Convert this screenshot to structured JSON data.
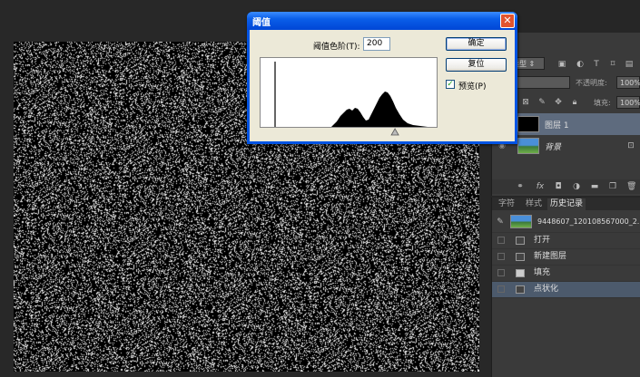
{
  "layers_panel": {
    "kind_label": "类型",
    "opacity_label": "不透明度:",
    "opacity_value": "100%",
    "fill_label": "填充:",
    "fill_value": "100%",
    "layers": [
      {
        "name": "图层 1",
        "thumb": "black",
        "selected": true
      },
      {
        "name": "背景",
        "thumb": "landscape",
        "italic": true
      }
    ]
  },
  "history_panel": {
    "tabs": [
      "字符",
      "样式",
      "历史记录"
    ],
    "active_tab": 2,
    "snapshot_name": "9448607_120108567000_2...",
    "items": [
      "打开",
      "新建图层",
      "填充",
      "点状化"
    ],
    "selected_index": 3
  },
  "dialog": {
    "title": "阈值",
    "threshold_label": "阈值色阶(T):",
    "threshold_value": "200",
    "ok_label": "确定",
    "reset_label": "复位",
    "preview_label": "预览(P)",
    "preview_checked": true,
    "threshold_fraction": 0.78
  },
  "colors": {
    "titlebar": "#0054e3",
    "dialog_bg": "#ece9d8",
    "panel_bg": "#3a3a3a",
    "selected_row": "#4c5a6c"
  }
}
